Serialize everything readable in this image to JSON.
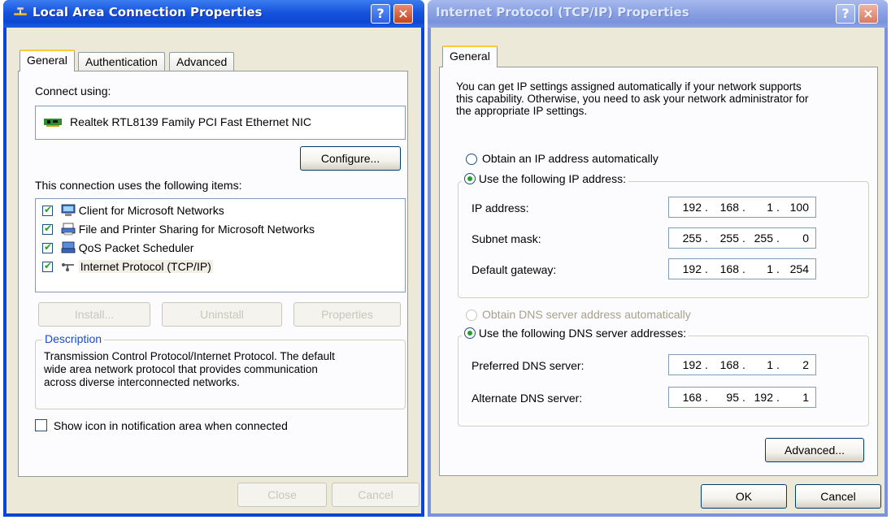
{
  "lan_dialog": {
    "title": "Local Area Connection Properties",
    "help_label": "?",
    "close_label": "×",
    "tabs": [
      "General",
      "Authentication",
      "Advanced"
    ],
    "connect_using_label": "Connect using:",
    "adapter_name": "Realtek RTL8139 Family PCI Fast Ethernet NIC",
    "configure_label": "Configure...",
    "items_label": "This connection uses the following items:",
    "items": [
      {
        "label": "Client for Microsoft Networks",
        "checked": true,
        "icon": "client-network-icon"
      },
      {
        "label": "File and Printer Sharing for Microsoft Networks",
        "checked": true,
        "icon": "file-printer-sharing-icon"
      },
      {
        "label": "QoS Packet Scheduler",
        "checked": true,
        "icon": "qos-scheduler-icon"
      },
      {
        "label": "Internet Protocol (TCP/IP)",
        "checked": true,
        "icon": "protocol-icon"
      }
    ],
    "install_label": "Install...",
    "uninstall_label": "Uninstall",
    "properties_label": "Properties",
    "description_title": "Description",
    "description_text": [
      "Transmission Control Protocol/Internet Protocol. The default",
      "wide area network protocol that provides communication",
      "across diverse interconnected networks."
    ],
    "show_icon_label": "Show icon in notification area when connected",
    "show_icon_checked": false,
    "close_button": "Close",
    "cancel_button": "Cancel"
  },
  "tcpip_dialog": {
    "title": "Internet Protocol (TCP/IP) Properties",
    "help_label": "?",
    "close_label": "×",
    "tab": "General",
    "intro": [
      "You can get IP settings assigned automatically if your network supports",
      "this capability. Otherwise, you need to ask your network administrator for",
      "the appropriate IP settings."
    ],
    "obtain_ip_label": "Obtain an IP address automatically",
    "use_ip_label": "Use the following IP address:",
    "ip_address_label": "IP address:",
    "ip_address": [
      "192",
      "168",
      "1",
      "100"
    ],
    "subnet_mask_label": "Subnet mask:",
    "subnet_mask": [
      "255",
      "255",
      "255",
      "0"
    ],
    "default_gateway_label": "Default gateway:",
    "default_gateway": [
      "192",
      "168",
      "1",
      "254"
    ],
    "obtain_dns_label": "Obtain DNS server address automatically",
    "use_dns_label": "Use the following DNS server addresses:",
    "preferred_dns_label": "Preferred DNS server:",
    "preferred_dns": [
      "192",
      "168",
      "1",
      "2"
    ],
    "alternate_dns_label": "Alternate DNS server:",
    "alternate_dns": [
      "168",
      "95",
      "192",
      "1"
    ],
    "advanced_label": "Advanced...",
    "ok_label": "OK",
    "cancel_label": "Cancel"
  },
  "colors": {
    "titlebar_active": "#0a45d8",
    "titlebar_inactive": "#7a93dc",
    "dialog_face": "#ece9d8",
    "panel": "#fcfcfe",
    "tab_highlight": "#ffc83c",
    "check_green": "#21a121",
    "disabled_text": "#a7a08b"
  }
}
